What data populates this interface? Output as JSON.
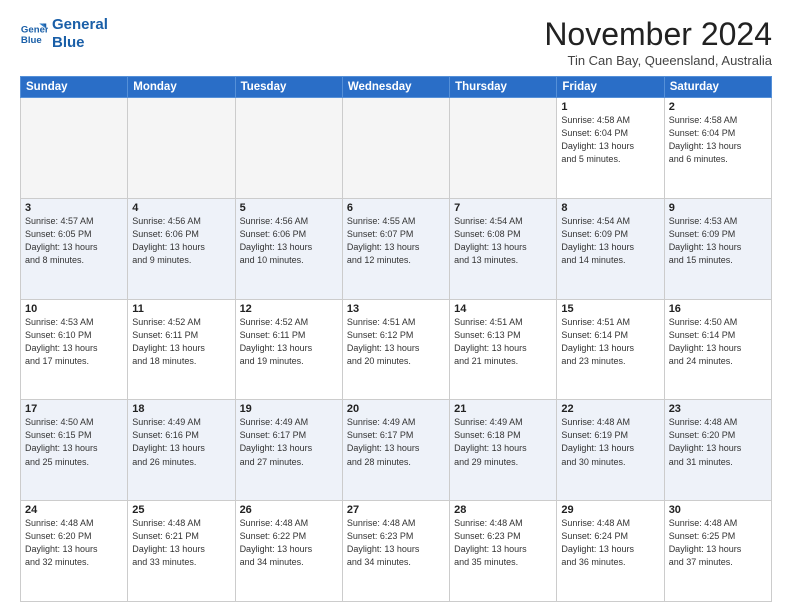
{
  "header": {
    "logo_line1": "General",
    "logo_line2": "Blue",
    "title": "November 2024",
    "location": "Tin Can Bay, Queensland, Australia"
  },
  "weekdays": [
    "Sunday",
    "Monday",
    "Tuesday",
    "Wednesday",
    "Thursday",
    "Friday",
    "Saturday"
  ],
  "weeks": [
    [
      {
        "day": "",
        "info": ""
      },
      {
        "day": "",
        "info": ""
      },
      {
        "day": "",
        "info": ""
      },
      {
        "day": "",
        "info": ""
      },
      {
        "day": "",
        "info": ""
      },
      {
        "day": "1",
        "info": "Sunrise: 4:58 AM\nSunset: 6:04 PM\nDaylight: 13 hours\nand 5 minutes."
      },
      {
        "day": "2",
        "info": "Sunrise: 4:58 AM\nSunset: 6:04 PM\nDaylight: 13 hours\nand 6 minutes."
      }
    ],
    [
      {
        "day": "3",
        "info": "Sunrise: 4:57 AM\nSunset: 6:05 PM\nDaylight: 13 hours\nand 8 minutes."
      },
      {
        "day": "4",
        "info": "Sunrise: 4:56 AM\nSunset: 6:06 PM\nDaylight: 13 hours\nand 9 minutes."
      },
      {
        "day": "5",
        "info": "Sunrise: 4:56 AM\nSunset: 6:06 PM\nDaylight: 13 hours\nand 10 minutes."
      },
      {
        "day": "6",
        "info": "Sunrise: 4:55 AM\nSunset: 6:07 PM\nDaylight: 13 hours\nand 12 minutes."
      },
      {
        "day": "7",
        "info": "Sunrise: 4:54 AM\nSunset: 6:08 PM\nDaylight: 13 hours\nand 13 minutes."
      },
      {
        "day": "8",
        "info": "Sunrise: 4:54 AM\nSunset: 6:09 PM\nDaylight: 13 hours\nand 14 minutes."
      },
      {
        "day": "9",
        "info": "Sunrise: 4:53 AM\nSunset: 6:09 PM\nDaylight: 13 hours\nand 15 minutes."
      }
    ],
    [
      {
        "day": "10",
        "info": "Sunrise: 4:53 AM\nSunset: 6:10 PM\nDaylight: 13 hours\nand 17 minutes."
      },
      {
        "day": "11",
        "info": "Sunrise: 4:52 AM\nSunset: 6:11 PM\nDaylight: 13 hours\nand 18 minutes."
      },
      {
        "day": "12",
        "info": "Sunrise: 4:52 AM\nSunset: 6:11 PM\nDaylight: 13 hours\nand 19 minutes."
      },
      {
        "day": "13",
        "info": "Sunrise: 4:51 AM\nSunset: 6:12 PM\nDaylight: 13 hours\nand 20 minutes."
      },
      {
        "day": "14",
        "info": "Sunrise: 4:51 AM\nSunset: 6:13 PM\nDaylight: 13 hours\nand 21 minutes."
      },
      {
        "day": "15",
        "info": "Sunrise: 4:51 AM\nSunset: 6:14 PM\nDaylight: 13 hours\nand 23 minutes."
      },
      {
        "day": "16",
        "info": "Sunrise: 4:50 AM\nSunset: 6:14 PM\nDaylight: 13 hours\nand 24 minutes."
      }
    ],
    [
      {
        "day": "17",
        "info": "Sunrise: 4:50 AM\nSunset: 6:15 PM\nDaylight: 13 hours\nand 25 minutes."
      },
      {
        "day": "18",
        "info": "Sunrise: 4:49 AM\nSunset: 6:16 PM\nDaylight: 13 hours\nand 26 minutes."
      },
      {
        "day": "19",
        "info": "Sunrise: 4:49 AM\nSunset: 6:17 PM\nDaylight: 13 hours\nand 27 minutes."
      },
      {
        "day": "20",
        "info": "Sunrise: 4:49 AM\nSunset: 6:17 PM\nDaylight: 13 hours\nand 28 minutes."
      },
      {
        "day": "21",
        "info": "Sunrise: 4:49 AM\nSunset: 6:18 PM\nDaylight: 13 hours\nand 29 minutes."
      },
      {
        "day": "22",
        "info": "Sunrise: 4:48 AM\nSunset: 6:19 PM\nDaylight: 13 hours\nand 30 minutes."
      },
      {
        "day": "23",
        "info": "Sunrise: 4:48 AM\nSunset: 6:20 PM\nDaylight: 13 hours\nand 31 minutes."
      }
    ],
    [
      {
        "day": "24",
        "info": "Sunrise: 4:48 AM\nSunset: 6:20 PM\nDaylight: 13 hours\nand 32 minutes."
      },
      {
        "day": "25",
        "info": "Sunrise: 4:48 AM\nSunset: 6:21 PM\nDaylight: 13 hours\nand 33 minutes."
      },
      {
        "day": "26",
        "info": "Sunrise: 4:48 AM\nSunset: 6:22 PM\nDaylight: 13 hours\nand 34 minutes."
      },
      {
        "day": "27",
        "info": "Sunrise: 4:48 AM\nSunset: 6:23 PM\nDaylight: 13 hours\nand 34 minutes."
      },
      {
        "day": "28",
        "info": "Sunrise: 4:48 AM\nSunset: 6:23 PM\nDaylight: 13 hours\nand 35 minutes."
      },
      {
        "day": "29",
        "info": "Sunrise: 4:48 AM\nSunset: 6:24 PM\nDaylight: 13 hours\nand 36 minutes."
      },
      {
        "day": "30",
        "info": "Sunrise: 4:48 AM\nSunset: 6:25 PM\nDaylight: 13 hours\nand 37 minutes."
      }
    ]
  ]
}
